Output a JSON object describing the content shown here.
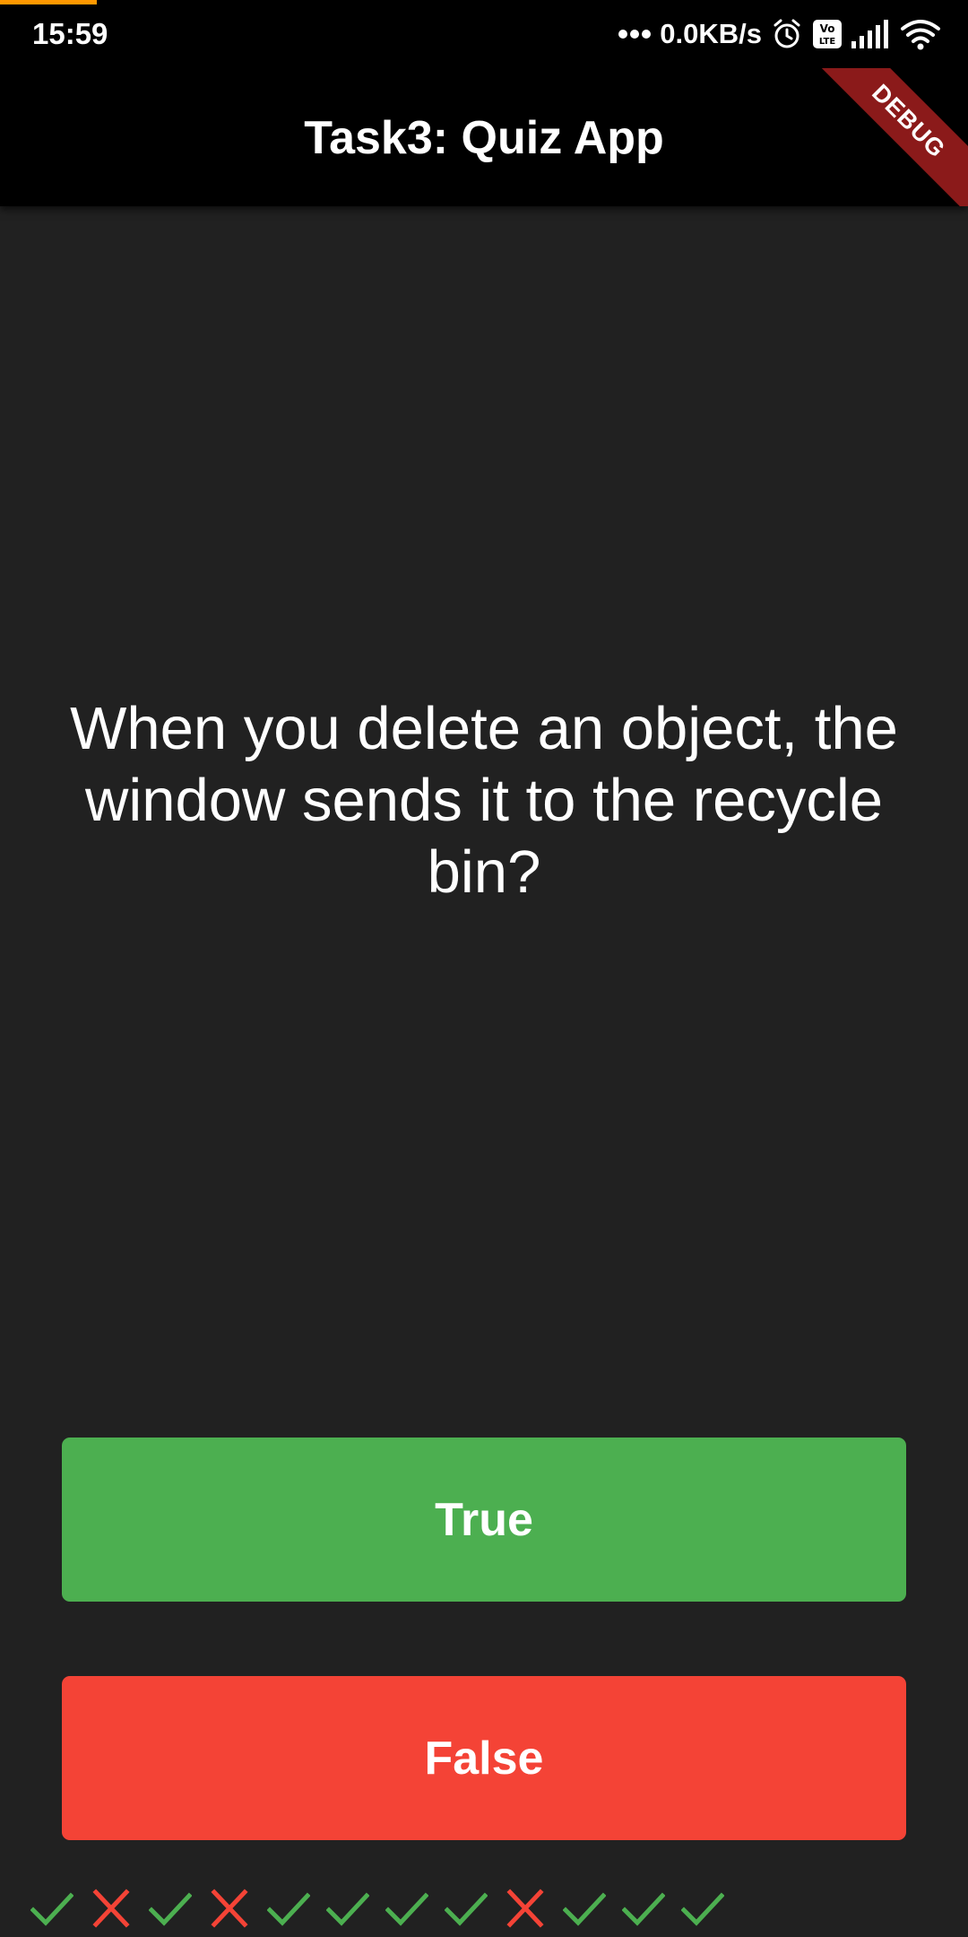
{
  "status_bar": {
    "time": "15:59",
    "network_speed": "0.0KB/s",
    "icons": [
      "more-dots-icon",
      "alarm-icon",
      "volte-icon",
      "signal-icon",
      "wifi-icon"
    ]
  },
  "app_bar": {
    "title": "Task3: Quiz App",
    "debug_banner": "DEBUG"
  },
  "question": {
    "text": "When you delete an object, the window sends it to the recycle bin?"
  },
  "buttons": {
    "true_label": "True",
    "false_label": "False"
  },
  "score_keeper": {
    "results": [
      "correct",
      "wrong",
      "correct",
      "wrong",
      "correct",
      "correct",
      "correct",
      "correct",
      "wrong",
      "correct",
      "correct",
      "correct"
    ]
  },
  "colors": {
    "background": "#212121",
    "app_bar": "#000000",
    "true_button": "#4caf50",
    "false_button": "#f44336",
    "check_icon": "#4caf50",
    "cross_icon": "#f44336",
    "debug_banner": "#8b1a1a",
    "status_progress": "#ff9800"
  }
}
